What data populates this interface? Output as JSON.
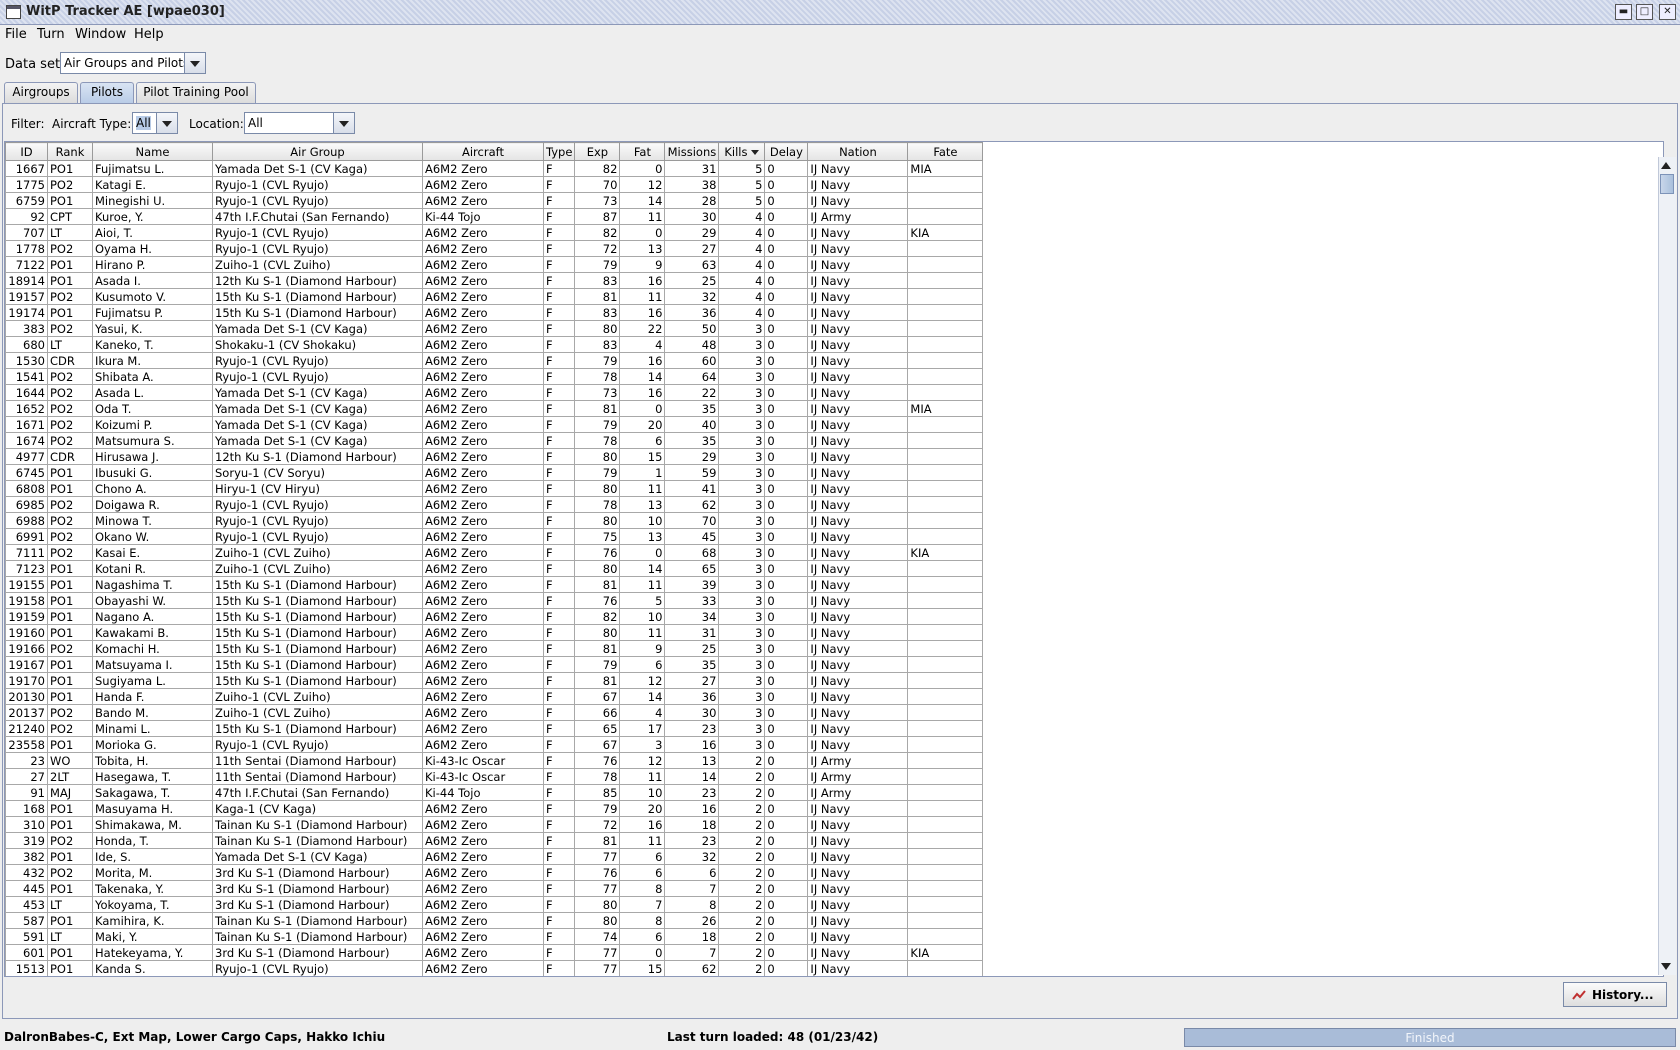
{
  "window": {
    "title": "WitP Tracker AE [wpae030]"
  },
  "menu": [
    "File",
    "Turn",
    "Window",
    "Help"
  ],
  "dataset": {
    "label": "Data set:",
    "value": "Air Groups and Pilots"
  },
  "tabs": [
    "Airgroups",
    "Pilots",
    "Pilot Training Pool"
  ],
  "active_tab": "Pilots",
  "filter": {
    "label": "Filter:",
    "aircraft_label": "Aircraft Type:",
    "aircraft_value": "All",
    "location_label": "Location:",
    "location_value": "All"
  },
  "table": {
    "columns": [
      "ID",
      "Rank",
      "Name",
      "Air Group",
      "Aircraft",
      "Type",
      "Exp",
      "Fat",
      "Missions",
      "Kills",
      "Delay",
      "Nation",
      "Fate"
    ],
    "sort_column": "Kills",
    "rows": [
      [
        "1667",
        "PO1",
        "Fujimatsu L.",
        "Yamada Det S-1 (CV Kaga)",
        "A6M2 Zero",
        "F",
        "82",
        "0",
        "31",
        "5",
        "0",
        "IJ Navy",
        "MIA"
      ],
      [
        "1775",
        "PO2",
        "Katagi E.",
        "Ryujo-1 (CVL Ryujo)",
        "A6M2 Zero",
        "F",
        "70",
        "12",
        "38",
        "5",
        "0",
        "IJ Navy",
        ""
      ],
      [
        "6759",
        "PO1",
        "Minegishi U.",
        "Ryujo-1 (CVL Ryujo)",
        "A6M2 Zero",
        "F",
        "73",
        "14",
        "28",
        "5",
        "0",
        "IJ Navy",
        ""
      ],
      [
        "92",
        "CPT",
        "Kuroe, Y.",
        "47th I.F.Chutai (San Fernando)",
        "Ki-44 Tojo",
        "F",
        "87",
        "11",
        "30",
        "4",
        "0",
        "IJ Army",
        ""
      ],
      [
        "707",
        "LT",
        "Aioi, T.",
        "Ryujo-1 (CVL Ryujo)",
        "A6M2 Zero",
        "F",
        "82",
        "0",
        "29",
        "4",
        "0",
        "IJ Navy",
        "KIA"
      ],
      [
        "1778",
        "PO2",
        "Oyama H.",
        "Ryujo-1 (CVL Ryujo)",
        "A6M2 Zero",
        "F",
        "72",
        "13",
        "27",
        "4",
        "0",
        "IJ Navy",
        ""
      ],
      [
        "7122",
        "PO1",
        "Hirano P.",
        "Zuiho-1 (CVL Zuiho)",
        "A6M2 Zero",
        "F",
        "79",
        "9",
        "63",
        "4",
        "0",
        "IJ Navy",
        ""
      ],
      [
        "18914",
        "PO1",
        "Asada I.",
        "12th Ku S-1  (Diamond Harbour)",
        "A6M2 Zero",
        "F",
        "83",
        "16",
        "25",
        "4",
        "0",
        "IJ Navy",
        ""
      ],
      [
        "19157",
        "PO2",
        "Kusumoto V.",
        "15th Ku S-1  (Diamond Harbour)",
        "A6M2 Zero",
        "F",
        "81",
        "11",
        "32",
        "4",
        "0",
        "IJ Navy",
        ""
      ],
      [
        "19174",
        "PO1",
        "Fujimatsu P.",
        "15th Ku S-1  (Diamond Harbour)",
        "A6M2 Zero",
        "F",
        "83",
        "16",
        "36",
        "4",
        "0",
        "IJ Navy",
        ""
      ],
      [
        "383",
        "PO2",
        "Yasui, K.",
        "Yamada Det S-1 (CV Kaga)",
        "A6M2 Zero",
        "F",
        "80",
        "22",
        "50",
        "3",
        "0",
        "IJ Navy",
        ""
      ],
      [
        "680",
        "LT",
        "Kaneko, T.",
        "Shokaku-1 (CV Shokaku)",
        "A6M2 Zero",
        "F",
        "83",
        "4",
        "48",
        "3",
        "0",
        "IJ Navy",
        ""
      ],
      [
        "1530",
        "CDR",
        "Ikura M.",
        "Ryujo-1 (CVL Ryujo)",
        "A6M2 Zero",
        "F",
        "79",
        "16",
        "60",
        "3",
        "0",
        "IJ Navy",
        ""
      ],
      [
        "1541",
        "PO2",
        "Shibata A.",
        "Ryujo-1 (CVL Ryujo)",
        "A6M2 Zero",
        "F",
        "78",
        "14",
        "64",
        "3",
        "0",
        "IJ Navy",
        ""
      ],
      [
        "1644",
        "PO2",
        "Asada L.",
        "Yamada Det S-1 (CV Kaga)",
        "A6M2 Zero",
        "F",
        "73",
        "16",
        "22",
        "3",
        "0",
        "IJ Navy",
        ""
      ],
      [
        "1652",
        "PO2",
        "Oda T.",
        "Yamada Det S-1 (CV Kaga)",
        "A6M2 Zero",
        "F",
        "81",
        "0",
        "35",
        "3",
        "0",
        "IJ Navy",
        "MIA"
      ],
      [
        "1671",
        "PO2",
        "Koizumi P.",
        "Yamada Det S-1 (CV Kaga)",
        "A6M2 Zero",
        "F",
        "79",
        "20",
        "40",
        "3",
        "0",
        "IJ Navy",
        ""
      ],
      [
        "1674",
        "PO2",
        "Matsumura S.",
        "Yamada Det S-1 (CV Kaga)",
        "A6M2 Zero",
        "F",
        "78",
        "6",
        "35",
        "3",
        "0",
        "IJ Navy",
        ""
      ],
      [
        "4977",
        "CDR",
        "Hirusawa J.",
        "12th Ku S-1  (Diamond Harbour)",
        "A6M2 Zero",
        "F",
        "80",
        "15",
        "29",
        "3",
        "0",
        "IJ Navy",
        ""
      ],
      [
        "6745",
        "PO1",
        "Ibusuki G.",
        "Soryu-1 (CV Soryu)",
        "A6M2 Zero",
        "F",
        "79",
        "1",
        "59",
        "3",
        "0",
        "IJ Navy",
        ""
      ],
      [
        "6808",
        "PO1",
        "Chono A.",
        "Hiryu-1 (CV Hiryu)",
        "A6M2 Zero",
        "F",
        "80",
        "11",
        "41",
        "3",
        "0",
        "IJ Navy",
        ""
      ],
      [
        "6985",
        "PO2",
        "Doigawa R.",
        "Ryujo-1 (CVL Ryujo)",
        "A6M2 Zero",
        "F",
        "78",
        "13",
        "62",
        "3",
        "0",
        "IJ Navy",
        ""
      ],
      [
        "6988",
        "PO2",
        "Minowa T.",
        "Ryujo-1 (CVL Ryujo)",
        "A6M2 Zero",
        "F",
        "80",
        "10",
        "70",
        "3",
        "0",
        "IJ Navy",
        ""
      ],
      [
        "6991",
        "PO2",
        "Okano W.",
        "Ryujo-1 (CVL Ryujo)",
        "A6M2 Zero",
        "F",
        "75",
        "13",
        "45",
        "3",
        "0",
        "IJ Navy",
        ""
      ],
      [
        "7111",
        "PO2",
        "Kasai E.",
        "Zuiho-1 (CVL Zuiho)",
        "A6M2 Zero",
        "F",
        "76",
        "0",
        "68",
        "3",
        "0",
        "IJ Navy",
        "KIA"
      ],
      [
        "7123",
        "PO1",
        "Kotani R.",
        "Zuiho-1 (CVL Zuiho)",
        "A6M2 Zero",
        "F",
        "80",
        "14",
        "65",
        "3",
        "0",
        "IJ Navy",
        ""
      ],
      [
        "19155",
        "PO1",
        "Nagashima T.",
        "15th Ku S-1  (Diamond Harbour)",
        "A6M2 Zero",
        "F",
        "81",
        "11",
        "39",
        "3",
        "0",
        "IJ Navy",
        ""
      ],
      [
        "19158",
        "PO1",
        "Obayashi W.",
        "15th Ku S-1  (Diamond Harbour)",
        "A6M2 Zero",
        "F",
        "76",
        "5",
        "33",
        "3",
        "0",
        "IJ Navy",
        ""
      ],
      [
        "19159",
        "PO1",
        "Nagano A.",
        "15th Ku S-1  (Diamond Harbour)",
        "A6M2 Zero",
        "F",
        "82",
        "10",
        "34",
        "3",
        "0",
        "IJ Navy",
        ""
      ],
      [
        "19160",
        "PO1",
        "Kawakami B.",
        "15th Ku S-1  (Diamond Harbour)",
        "A6M2 Zero",
        "F",
        "80",
        "11",
        "31",
        "3",
        "0",
        "IJ Navy",
        ""
      ],
      [
        "19166",
        "PO2",
        "Komachi H.",
        "15th Ku S-1  (Diamond Harbour)",
        "A6M2 Zero",
        "F",
        "81",
        "9",
        "25",
        "3",
        "0",
        "IJ Navy",
        ""
      ],
      [
        "19167",
        "PO1",
        "Matsuyama I.",
        "15th Ku S-1  (Diamond Harbour)",
        "A6M2 Zero",
        "F",
        "79",
        "6",
        "35",
        "3",
        "0",
        "IJ Navy",
        ""
      ],
      [
        "19170",
        "PO1",
        "Sugiyama L.",
        "15th Ku S-1  (Diamond Harbour)",
        "A6M2 Zero",
        "F",
        "81",
        "12",
        "27",
        "3",
        "0",
        "IJ Navy",
        ""
      ],
      [
        "20130",
        "PO1",
        "Handa F.",
        "Zuiho-1 (CVL Zuiho)",
        "A6M2 Zero",
        "F",
        "67",
        "14",
        "36",
        "3",
        "0",
        "IJ Navy",
        ""
      ],
      [
        "20137",
        "PO2",
        "Bando M.",
        "Zuiho-1 (CVL Zuiho)",
        "A6M2 Zero",
        "F",
        "66",
        "4",
        "30",
        "3",
        "0",
        "IJ Navy",
        ""
      ],
      [
        "21240",
        "PO2",
        "Minami L.",
        "15th Ku S-1  (Diamond Harbour)",
        "A6M2 Zero",
        "F",
        "65",
        "17",
        "23",
        "3",
        "0",
        "IJ Navy",
        ""
      ],
      [
        "23558",
        "PO1",
        "Morioka G.",
        "Ryujo-1 (CVL Ryujo)",
        "A6M2 Zero",
        "F",
        "67",
        "3",
        "16",
        "3",
        "0",
        "IJ Navy",
        ""
      ],
      [
        "23",
        "WO",
        "Tobita, H.",
        "11th Sentai (Diamond Harbour)",
        "Ki-43-Ic Oscar",
        "F",
        "76",
        "12",
        "13",
        "2",
        "0",
        "IJ Army",
        ""
      ],
      [
        "27",
        "2LT",
        "Hasegawa, T.",
        "11th Sentai (Diamond Harbour)",
        "Ki-43-Ic Oscar",
        "F",
        "78",
        "11",
        "14",
        "2",
        "0",
        "IJ Army",
        ""
      ],
      [
        "91",
        "MAJ",
        "Sakagawa, T.",
        "47th I.F.Chutai (San Fernando)",
        "Ki-44 Tojo",
        "F",
        "85",
        "10",
        "23",
        "2",
        "0",
        "IJ Army",
        ""
      ],
      [
        "168",
        "PO1",
        "Masuyama H.",
        "Kaga-1 (CV Kaga)",
        "A6M2 Zero",
        "F",
        "79",
        "20",
        "16",
        "2",
        "0",
        "IJ Navy",
        ""
      ],
      [
        "310",
        "PO1",
        "Shimakawa, M.",
        "Tainan Ku S-1 (Diamond Harbour)",
        "A6M2 Zero",
        "F",
        "72",
        "16",
        "18",
        "2",
        "0",
        "IJ Navy",
        ""
      ],
      [
        "319",
        "PO2",
        "Honda, T.",
        "Tainan Ku S-1 (Diamond Harbour)",
        "A6M2 Zero",
        "F",
        "81",
        "11",
        "23",
        "2",
        "0",
        "IJ Navy",
        ""
      ],
      [
        "382",
        "PO1",
        "Ide, S.",
        "Yamada Det S-1 (CV Kaga)",
        "A6M2 Zero",
        "F",
        "77",
        "6",
        "32",
        "2",
        "0",
        "IJ Navy",
        ""
      ],
      [
        "432",
        "PO2",
        "Morita, M.",
        "3rd Ku S-1 (Diamond Harbour)",
        "A6M2 Zero",
        "F",
        "76",
        "6",
        "6",
        "2",
        "0",
        "IJ Navy",
        ""
      ],
      [
        "445",
        "PO1",
        "Takenaka, Y.",
        "3rd Ku S-1 (Diamond Harbour)",
        "A6M2 Zero",
        "F",
        "77",
        "8",
        "7",
        "2",
        "0",
        "IJ Navy",
        ""
      ],
      [
        "453",
        "LT",
        "Yokoyama, T.",
        "3rd Ku S-1 (Diamond Harbour)",
        "A6M2 Zero",
        "F",
        "80",
        "7",
        "8",
        "2",
        "0",
        "IJ Navy",
        ""
      ],
      [
        "587",
        "PO1",
        "Kamihira, K.",
        "Tainan Ku S-1 (Diamond Harbour)",
        "A6M2 Zero",
        "F",
        "80",
        "8",
        "26",
        "2",
        "0",
        "IJ Navy",
        ""
      ],
      [
        "591",
        "LT",
        "Maki, Y.",
        "Tainan Ku S-1 (Diamond Harbour)",
        "A6M2 Zero",
        "F",
        "74",
        "6",
        "18",
        "2",
        "0",
        "IJ Navy",
        ""
      ],
      [
        "601",
        "PO1",
        "Hatekeyama, Y.",
        "3rd Ku S-1 (Diamond Harbour)",
        "A6M2 Zero",
        "F",
        "77",
        "0",
        "7",
        "2",
        "0",
        "IJ Navy",
        "KIA"
      ],
      [
        "1513",
        "PO1",
        "Kanda S.",
        "Ryujo-1 (CVL Ryujo)",
        "A6M2 Zero",
        "F",
        "77",
        "15",
        "62",
        "2",
        "0",
        "IJ Navy",
        ""
      ]
    ]
  },
  "history_button": "History...",
  "status": {
    "left": "DalronBabes-C, Ext Map, Lower Cargo Caps, Hakko Ichiu",
    "center": "Last turn loaded: 48 (01/23/42)",
    "progress_text": "Finished",
    "progress_fraction": 1.0
  }
}
